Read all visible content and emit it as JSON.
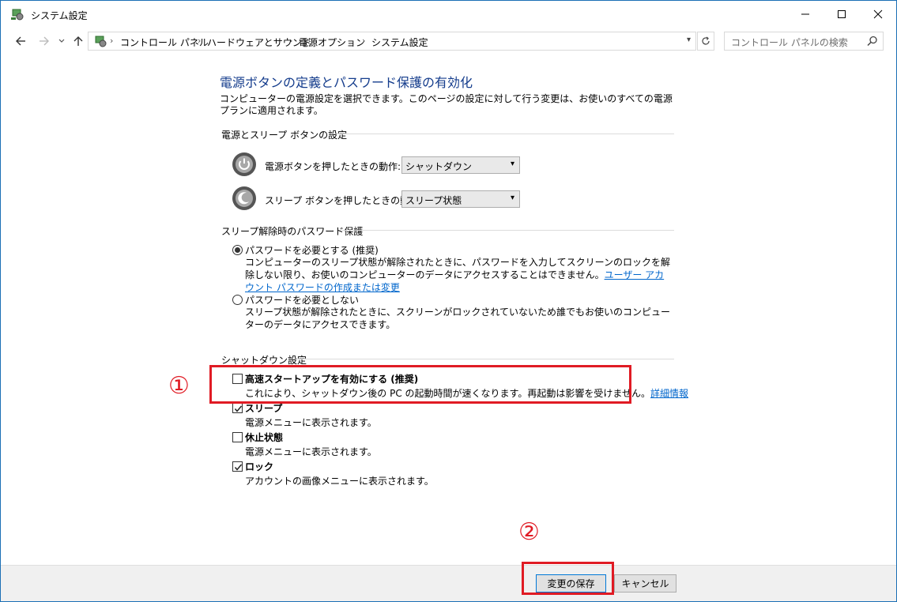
{
  "window": {
    "title": "システム設定"
  },
  "nav": {
    "breadcrumbs": [
      "コントロール パネル",
      "ハードウェアとサウンド",
      "電源オプション",
      "システム設定"
    ],
    "search_placeholder": "コントロール パネルの検索"
  },
  "page": {
    "heading": "電源ボタンの定義とパスワード保護の有効化",
    "description": "コンピューターの電源設定を選択できます。このページの設定に対して行う変更は、お使いのすべての電源プランに適用されます。"
  },
  "power_section": {
    "title": "電源とスリープ ボタンの設定",
    "power_button_label": "電源ボタンを押したときの動作:",
    "power_button_value": "シャットダウン",
    "sleep_button_label": "スリープ ボタンを押したときの動作:",
    "sleep_button_value": "スリープ状態"
  },
  "password_section": {
    "title": "スリープ解除時のパスワード保護",
    "require_title": "パスワードを必要とする (推奨)",
    "require_text": "コンピューターのスリープ状態が解除されたときに、パスワードを入力してスクリーンのロックを解除しない限り、お使いのコンピューターのデータにアクセスすることはできません。",
    "require_link": "ユーザー アカウント パスワードの作成または変更",
    "norequire_title": "パスワードを必要としない",
    "norequire_text": "スリープ状態が解除されたときに、スクリーンがロックされていないため誰でもお使いのコンピューターのデータにアクセスできます。",
    "selected": "require"
  },
  "shutdown_section": {
    "title": "シャットダウン設定",
    "items": [
      {
        "title": "高速スタートアップを有効にする (推奨)",
        "text": "これにより、シャットダウン後の PC の起動時間が速くなります。再起動は影響を受けません。",
        "link": "詳細情報",
        "checked": false
      },
      {
        "title": "スリープ",
        "text": "電源メニューに表示されます。",
        "checked": true
      },
      {
        "title": "休止状態",
        "text": "電源メニューに表示されます。",
        "checked": false
      },
      {
        "title": "ロック",
        "text": "アカウントの画像メニューに表示されます。",
        "checked": true
      }
    ]
  },
  "annotations": {
    "marker1": "①",
    "marker2": "②",
    "highlight_color": "#e01b24"
  },
  "footer": {
    "save_label": "変更の保存",
    "cancel_label": "キャンセル"
  }
}
